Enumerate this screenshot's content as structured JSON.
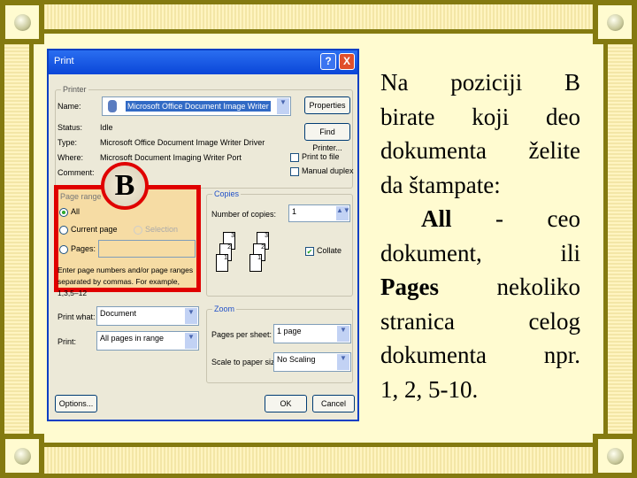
{
  "dialog": {
    "title": "Print",
    "help": "?",
    "close": "X",
    "printer": {
      "group": "Printer",
      "name_label": "Name:",
      "name_value": "Microsoft Office Document Image Writer",
      "status_label": "Status:",
      "status_value": "Idle",
      "type_label": "Type:",
      "type_value": "Microsoft Office Document Image Writer Driver",
      "where_label": "Where:",
      "where_value": "Microsoft Document Imaging Writer Port",
      "comment_label": "Comment:",
      "properties": "Properties",
      "find_printer": "Find Printer...",
      "print_to_file": "Print to file",
      "manual_duplex": "Manual duplex"
    },
    "page_range": {
      "group": "Page range",
      "all": "All",
      "current": "Current page",
      "selection": "Selection",
      "pages": "Pages:",
      "hint": "Enter page numbers and/or page ranges separated by commas. For example, 1,3,5–12",
      "selected": "All"
    },
    "copies": {
      "group": "Copies",
      "number_label": "Number of copies:",
      "number_value": "1",
      "collate": "Collate",
      "collate_checked": true
    },
    "print_what_label": "Print what:",
    "print_what_value": "Document",
    "print_label": "Print:",
    "print_value": "All pages in range",
    "zoom": {
      "group": "Zoom",
      "pps_label": "Pages per sheet:",
      "pps_value": "1 page",
      "scale_label": "Scale to paper size:",
      "scale_value": "No Scaling"
    },
    "options": "Options...",
    "ok": "OK",
    "cancel": "Cancel"
  },
  "marker": "B",
  "marker_color": "#e00000",
  "text_lines": [
    [
      "Na",
      "poziciji",
      "B"
    ],
    [
      "birate",
      "koji",
      "deo"
    ],
    [
      "dokumenta",
      "želite"
    ],
    [
      "da štampate:"
    ],
    [
      "All",
      "-",
      "ceo"
    ],
    [
      "dokument,",
      "ili"
    ],
    [
      "Pages",
      "nekoliko"
    ],
    [
      "stranica",
      "celog"
    ],
    [
      "dokumenta",
      "npr."
    ],
    [
      "1, 2, 5-10."
    ]
  ]
}
